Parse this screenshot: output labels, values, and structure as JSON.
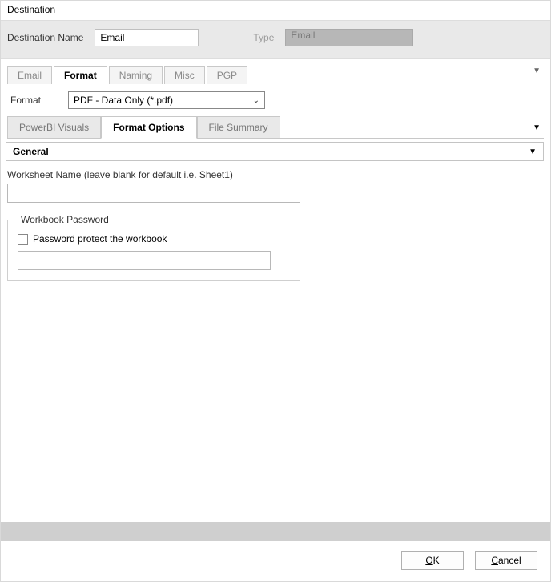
{
  "window": {
    "title": "Destination"
  },
  "header": {
    "destNameLabel": "Destination Name",
    "destNameValue": "Email",
    "typeLabel": "Type",
    "typeValue": "Email"
  },
  "mainTabs": {
    "items": [
      {
        "label": "Email"
      },
      {
        "label": "Format"
      },
      {
        "label": "Naming"
      },
      {
        "label": "Misc"
      },
      {
        "label": "PGP"
      }
    ],
    "activeIndex": 1
  },
  "format": {
    "label": "Format",
    "selected": "PDF - Data Only (*.pdf)"
  },
  "subTabs": {
    "items": [
      {
        "label": "PowerBI Visuals"
      },
      {
        "label": "Format Options"
      },
      {
        "label": "File Summary"
      }
    ],
    "activeIndex": 1
  },
  "section": {
    "title": "General"
  },
  "worksheet": {
    "label": "Worksheet Name (leave blank for default i.e.  Sheet1)",
    "value": ""
  },
  "workbookPassword": {
    "legend": "Workbook Password",
    "checkboxLabel": "Password protect  the workbook",
    "checked": false,
    "value": ""
  },
  "buttons": {
    "ok": {
      "pre": "",
      "u": "O",
      "post": "K"
    },
    "cancel": {
      "pre": "",
      "u": "C",
      "post": "ancel"
    }
  }
}
